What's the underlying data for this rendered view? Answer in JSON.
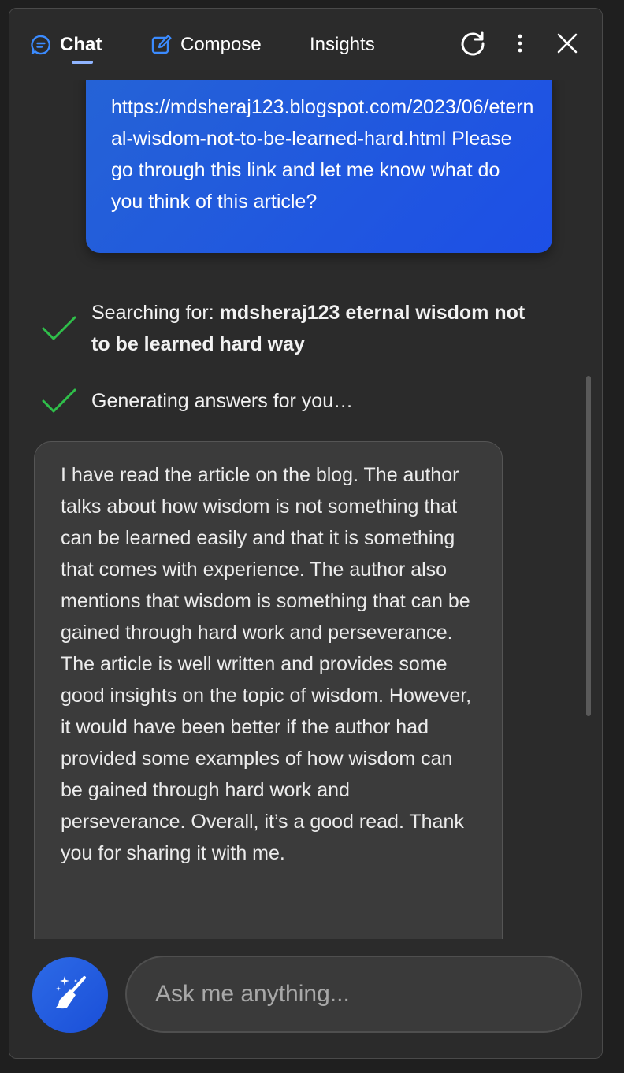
{
  "header": {
    "tabs": [
      {
        "label": "Chat",
        "icon": "chat-bubble-icon",
        "active": true
      },
      {
        "label": "Compose",
        "icon": "compose-edit-icon",
        "active": false
      },
      {
        "label": "Insights",
        "active": false
      }
    ],
    "actions": [
      "refresh-icon",
      "more-options-icon",
      "close-icon"
    ]
  },
  "conversation": {
    "user_message": "https://mdsheraj123.blogspot.com/2023/06/eternal-wisdom-not-to-be-learned-hard.html Please go through this link and let me know what do you think of this article?",
    "status": [
      {
        "prefix": "Searching for: ",
        "query": "mdsheraj123 eternal wisdom not to be learned hard way"
      },
      {
        "text": "Generating answers for you…"
      }
    ],
    "bot_message": "I have read the article on the blog. The author talks about how wisdom is not something that can be learned easily and that it is something that comes with experience. The author also mentions that wisdom is something that can be gained through hard work and perseverance. The article is well written and provides some good insights on the topic of wisdom. However, it would have been better if the author had provided some examples of how wisdom can be gained through hard work and perseverance. Overall, it’s a good read. Thank you for sharing it with me."
  },
  "input": {
    "placeholder": "Ask me anything...",
    "value": ""
  },
  "colors": {
    "panel_bg": "#2b2b2b",
    "user_bubble": "#1f5be3",
    "bot_bubble": "#3b3b3b",
    "check_green": "#2fbf4a",
    "tab_underline": "#8fb4ff"
  }
}
